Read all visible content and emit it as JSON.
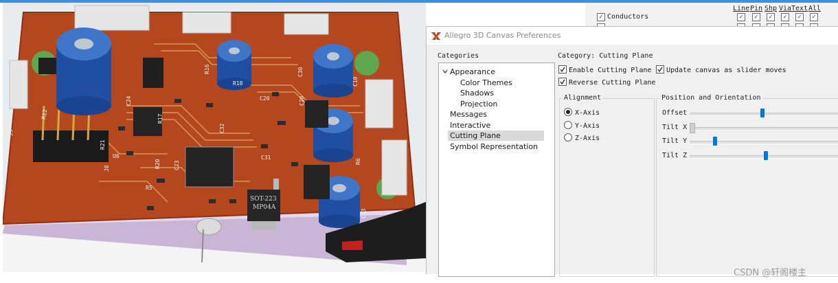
{
  "visibility_panel": {
    "columns": [
      "Line",
      "Pin",
      "Shp",
      "Via",
      "Text",
      "All"
    ],
    "rows": [
      {
        "label": "Conductors",
        "checked": true
      }
    ]
  },
  "dialog": {
    "title": "Allegro 3D Canvas Preferences",
    "categories_label": "Categories",
    "category_title": "Category: Cutting Plane",
    "tree": [
      {
        "label": "Appearance",
        "level": 0,
        "expanded": true,
        "selected": false
      },
      {
        "label": "Color Themes",
        "level": 1,
        "selected": false
      },
      {
        "label": "Shadows",
        "level": 1,
        "selected": false
      },
      {
        "label": "Projection",
        "level": 1,
        "selected": false
      },
      {
        "label": "Messages",
        "level": 0,
        "selected": false
      },
      {
        "label": "Interactive",
        "level": 0,
        "selected": false
      },
      {
        "label": "Cutting Plane",
        "level": 0,
        "selected": true
      },
      {
        "label": "Symbol Representation",
        "level": 0,
        "selected": false
      }
    ],
    "options": {
      "enable_cutting_plane": {
        "label": "Enable Cutting Plane",
        "checked": true
      },
      "update_canvas": {
        "label": "Update canvas as slider moves",
        "checked": true
      },
      "reverse_cutting_plane": {
        "label": "Reverse Cutting Plane",
        "checked": true
      }
    },
    "alignment": {
      "title": "Alignment",
      "options": [
        {
          "label": "X-Axis",
          "selected": true
        },
        {
          "label": "Y-Axis",
          "selected": false
        },
        {
          "label": "Z-Axis",
          "selected": false
        }
      ]
    },
    "position_orientation": {
      "title": "Position and Orientation",
      "sliders": [
        {
          "label": "Offset",
          "value": 0.49,
          "enabled": true
        },
        {
          "label": "Tilt X",
          "value": 0.0,
          "enabled": false
        },
        {
          "label": "Tilt Y",
          "value": 0.16,
          "enabled": true
        },
        {
          "label": "Tilt Z",
          "value": 0.51,
          "enabled": true
        }
      ]
    }
  },
  "pcb": {
    "silkscreen": [
      "R12",
      "R16",
      "R18",
      "C28",
      "C30",
      "C10",
      "C24",
      "R17",
      "C32",
      "C20",
      "R20",
      "R21",
      "U6",
      "C23",
      "R5",
      "C31",
      "J3",
      "J8",
      "C13",
      "R6"
    ],
    "chip_text": [
      "SOT-223",
      "MP04A"
    ]
  },
  "watermark": "CSDN @轩阁楼主",
  "colors": {
    "accent": "#0078d7",
    "board": "#b5471f",
    "topbar": "#3d8fe3"
  }
}
